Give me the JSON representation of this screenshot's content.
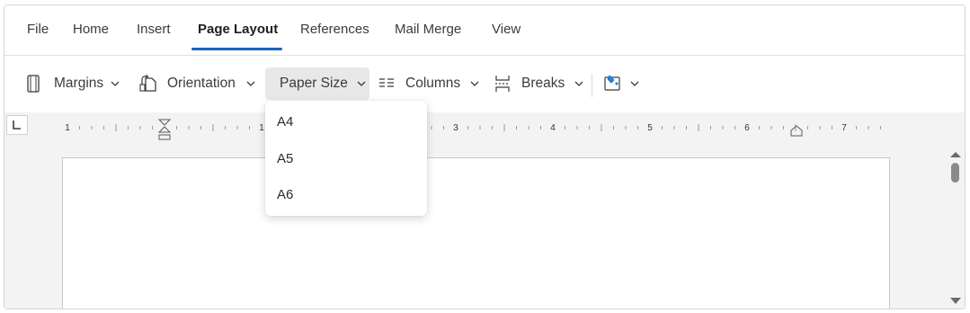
{
  "tabs": [
    {
      "label": "File"
    },
    {
      "label": "Home"
    },
    {
      "label": "Insert"
    },
    {
      "label": "Page Layout",
      "active": true
    },
    {
      "label": "References"
    },
    {
      "label": "Mail Merge"
    },
    {
      "label": "View"
    }
  ],
  "toolbar": {
    "margins_label": "Margins",
    "orientation_label": "Orientation",
    "paper_size_label": "Paper Size",
    "columns_label": "Columns",
    "breaks_label": "Breaks",
    "icons": {
      "margins": "margins-icon",
      "orientation": "orientation-icon",
      "columns": "columns-icon",
      "breaks": "breaks-icon",
      "page_color": "page-color-icon"
    }
  },
  "paper_size_menu": {
    "items": [
      {
        "label": "A4"
      },
      {
        "label": "A5"
      },
      {
        "label": "A6"
      }
    ]
  },
  "ruler": {
    "numbers": [
      "1",
      "1",
      "3",
      "4",
      "5",
      "6",
      "7"
    ]
  },
  "colors": {
    "accent": "#1565c0",
    "selected_bg": "#e8e8e8",
    "doc_bg": "#f3f3f3"
  }
}
